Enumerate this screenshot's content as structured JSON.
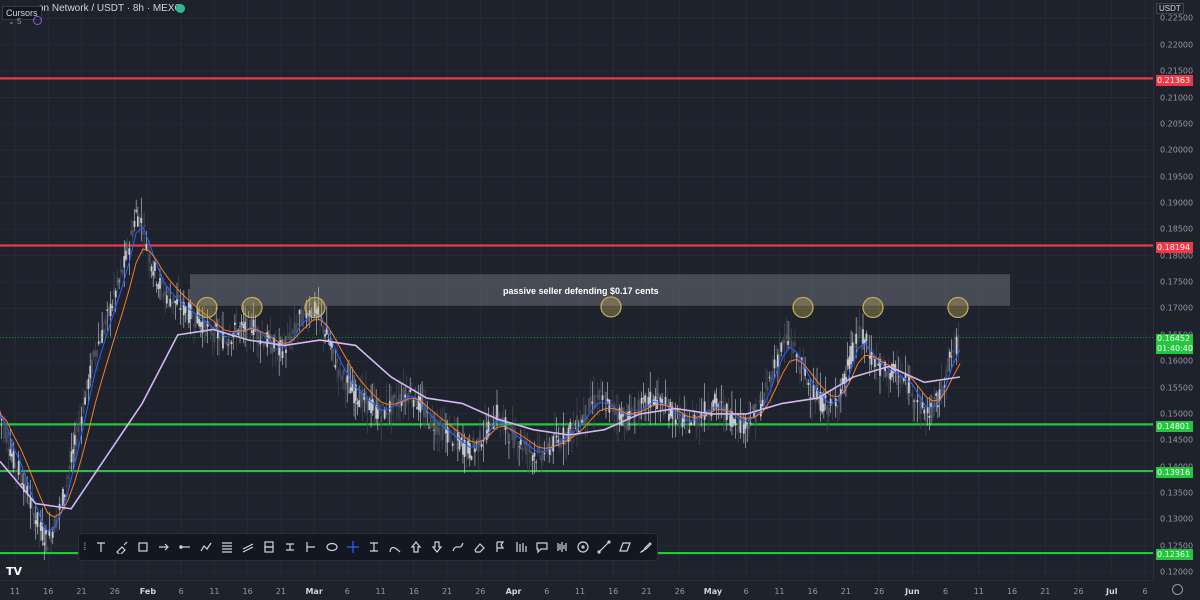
{
  "header": {
    "title": "on Network / USDT · 8h · MEXC",
    "cursor_tooltip": "Cursors",
    "cursor_count": "5",
    "currency": "USDT"
  },
  "annotation": "passive seller defending $0.17 cents",
  "price_axis": {
    "ticks": [
      "0.22500",
      "0.22000",
      "0.21500",
      "0.21000",
      "0.20500",
      "0.20000",
      "0.19500",
      "0.19000",
      "0.18500",
      "0.18000",
      "0.17500",
      "0.17000",
      "0.16500",
      "0.16000",
      "0.15500",
      "0.15000",
      "0.14500",
      "0.14000",
      "0.13500",
      "0.13000",
      "0.12500",
      "0.12000"
    ],
    "range": [
      0.1185,
      0.2285
    ]
  },
  "price_labels": {
    "resistance_top": "0.21363",
    "resistance_mid": "0.18194",
    "last_price": "0.16452",
    "countdown": "01:40:40",
    "support_1": "0.14801",
    "support_2": "0.13916",
    "support_3": "0.12361"
  },
  "time_axis": {
    "labels": [
      "11",
      "16",
      "21",
      "26",
      "Feb",
      "6",
      "11",
      "16",
      "21",
      "Mar",
      "6",
      "11",
      "16",
      "21",
      "26",
      "Apr",
      "6",
      "11",
      "16",
      "21",
      "26",
      "May",
      "6",
      "11",
      "16",
      "21",
      "26",
      "Jun",
      "6",
      "11",
      "16",
      "21",
      "26",
      "Jul",
      "6"
    ]
  },
  "colors": {
    "resistance": "#f23645",
    "support": "#22c73c",
    "ema_fast": "#2962ff",
    "ema_mid": "#f57c2b",
    "ema_slow": "#d4b8f0",
    "zone": "#9598a1",
    "circle": "#c9b15a",
    "last_price": "#22c73c"
  },
  "chart_data": {
    "type": "candlestick",
    "close_series": [
      0.15,
      0.146,
      0.141,
      0.139,
      0.135,
      0.131,
      0.128,
      0.126,
      0.129,
      0.133,
      0.138,
      0.144,
      0.15,
      0.156,
      0.162,
      0.165,
      0.169,
      0.173,
      0.177,
      0.182,
      0.188,
      0.186,
      0.18,
      0.176,
      0.173,
      0.172,
      0.171,
      0.17,
      0.169,
      0.168,
      0.167,
      0.166,
      0.165,
      0.164,
      0.165,
      0.166,
      0.166,
      0.167,
      0.165,
      0.164,
      0.163,
      0.162,
      0.163,
      0.165,
      0.168,
      0.169,
      0.17,
      0.168,
      0.165,
      0.161,
      0.158,
      0.156,
      0.154,
      0.153,
      0.152,
      0.151,
      0.15,
      0.151,
      0.152,
      0.153,
      0.154,
      0.153,
      0.151,
      0.149,
      0.148,
      0.147,
      0.146,
      0.145,
      0.144,
      0.143,
      0.144,
      0.146,
      0.148,
      0.15,
      0.148,
      0.146,
      0.145,
      0.144,
      0.143,
      0.142,
      0.143,
      0.144,
      0.145,
      0.146,
      0.147,
      0.148,
      0.15,
      0.152,
      0.153,
      0.152,
      0.151,
      0.15,
      0.149,
      0.15,
      0.151,
      0.152,
      0.153,
      0.152,
      0.151,
      0.15,
      0.149,
      0.148,
      0.149,
      0.15,
      0.151,
      0.152,
      0.151,
      0.15,
      0.149,
      0.148,
      0.149,
      0.15,
      0.152,
      0.156,
      0.16,
      0.163,
      0.164,
      0.161,
      0.158,
      0.155,
      0.153,
      0.152,
      0.151,
      0.153,
      0.156,
      0.161,
      0.165,
      0.164,
      0.161,
      0.159,
      0.158,
      0.158,
      0.157,
      0.156,
      0.155,
      0.152,
      0.15,
      0.151,
      0.153,
      0.158,
      0.162,
      0.164
    ],
    "ema_slow_anchor": [
      0.141,
      0.133,
      0.132,
      0.142,
      0.152,
      0.165,
      0.166,
      0.164,
      0.163,
      0.164,
      0.163,
      0.157,
      0.153,
      0.152,
      0.149,
      0.147,
      0.146,
      0.147,
      0.15,
      0.151,
      0.15,
      0.15,
      0.152,
      0.153,
      0.157,
      0.159,
      0.156,
      0.157
    ],
    "horizontal_levels": [
      0.21363,
      0.18194,
      0.14801,
      0.13916,
      0.12361
    ],
    "zone": [
      0.1705,
      0.1765
    ],
    "touch_prices": [
      0.17,
      0.17,
      0.17,
      0.1701,
      0.17,
      0.17,
      0.17
    ]
  },
  "toolbar": {
    "tools": [
      "text-tool-icon",
      "brush-tool-icon",
      "rectangle-tool-icon",
      "arrow-marker-icon",
      "horizontal-ray-icon",
      "path-tool-icon",
      "fib-retracement-icon",
      "parallel-channel-icon",
      "long-position-icon",
      "short-position-icon",
      "price-range-icon",
      "ellipse-tool-icon",
      "crosshair-icon",
      "date-price-range-icon",
      "arc-tool-icon",
      "arrow-up-icon",
      "arrow-down-icon",
      "curve-tool-icon",
      "eraser-icon",
      "flag-icon",
      "ruler-icon",
      "comment-icon",
      "volume-profile-icon",
      "circle-tool-icon",
      "trend-line-icon",
      "parallelogram-icon",
      "brush-alt-icon"
    ]
  }
}
